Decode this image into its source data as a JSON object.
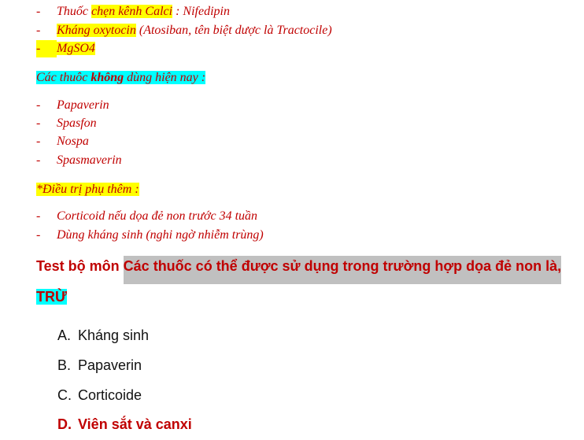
{
  "list1": [
    {
      "pre": "Thuốc ",
      "hl": "chẹn kênh Calci",
      "post": " : Nifedipin"
    },
    {
      "pre": "",
      "hl": "Kháng oxytocin",
      "post": " (Atosiban, tên biệt dược là Tractocile)"
    },
    {
      "pre": "",
      "hl": "MgSO4",
      "post": ""
    }
  ],
  "heading1": {
    "pre": "Các thuôc ",
    "bold": "không",
    "post": " dùng hiện nay :"
  },
  "list2": [
    "Papaverin",
    "Spasfon",
    "Nospa",
    "Spasmaverin"
  ],
  "heading2": "*Điều trị phụ thêm :",
  "list3": [
    "Corticoid nếu dọa đẻ non trước 34 tuần",
    "Dùng kháng sinh (nghi ngờ nhiễm trùng)"
  ],
  "dash": "-",
  "question": {
    "prefix": "Test bộ môn ",
    "highlighted": "Các thuốc có thể được sử dụng trong trường hợp dọa đẻ non là,",
    "tail": "TRỪ"
  },
  "answers": [
    {
      "label": "A.",
      "text": "Kháng sinh"
    },
    {
      "label": "B.",
      "text": "Papaverin"
    },
    {
      "label": "C.",
      "text": "Corticoide"
    },
    {
      "label": "D.",
      "text": "Viên sắt và canxi"
    }
  ],
  "colors": {
    "text_red": "#c00000",
    "highlight_yellow": "#ffff00",
    "highlight_cyan": "#00ffff",
    "highlight_gray": "#c0c0c0"
  }
}
